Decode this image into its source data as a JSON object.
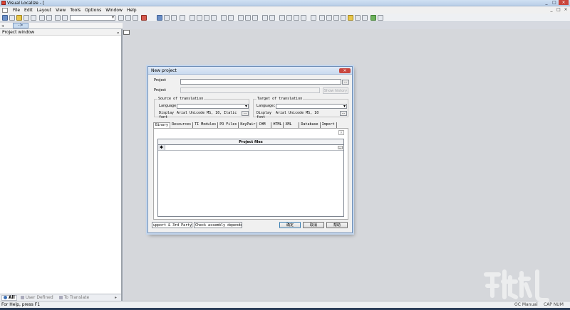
{
  "window": {
    "title": "Visual Localize - [",
    "controls": [
      "_",
      "□",
      "×"
    ]
  },
  "menu": {
    "items": [
      "File",
      "Edit",
      "Layout",
      "View",
      "Tools",
      "Options",
      "Window",
      "Help"
    ],
    "mdi_controls": [
      "_",
      "□",
      "×"
    ]
  },
  "toolbar": {
    "combo_value": ""
  },
  "tabstrip": {
    "left_arrow": "◂",
    "right_arrow": "->"
  },
  "project_window": {
    "title": "Project window",
    "pin": "ᵩ",
    "tabs": [
      {
        "label": "All",
        "active": true
      },
      {
        "label": "User Defined",
        "active": false
      },
      {
        "label": "To Translate",
        "active": false
      }
    ],
    "scroll_right": "▸"
  },
  "status": {
    "help": "For Help, press F1",
    "mode": "OC Manual",
    "caps": "CAP NUM SCRL"
  },
  "dialog": {
    "title": "New project",
    "close": "×",
    "project_label": "Project",
    "project_value": "",
    "browse": "...",
    "project2_label": "Project",
    "show_history": "Show history",
    "source": {
      "title": "Source of translation",
      "language_label": "Language:",
      "language_value": "",
      "display_label": "Display font",
      "font": "Arial Unicode MS, 10, Italic"
    },
    "target": {
      "title": "Target of translation",
      "language_label": "Language:",
      "language_value": "",
      "display_label": "Display font",
      "font": "Arial Unicode MS, 10"
    },
    "tabs": [
      "Binary",
      "Resources",
      "TI Modules",
      "PO Files",
      "KeyPair",
      "CHM",
      "HTML",
      "XML",
      "Database",
      "Import"
    ],
    "panel_close": "×",
    "grid": {
      "header": "Project files",
      "row_marker": "✱",
      "row_button": "..."
    },
    "opt1": "upport & 3rd Party DLL",
    "opt2": "Check assembly dependencies",
    "ok": "确定",
    "cancel": "取消",
    "help": "帮助"
  }
}
